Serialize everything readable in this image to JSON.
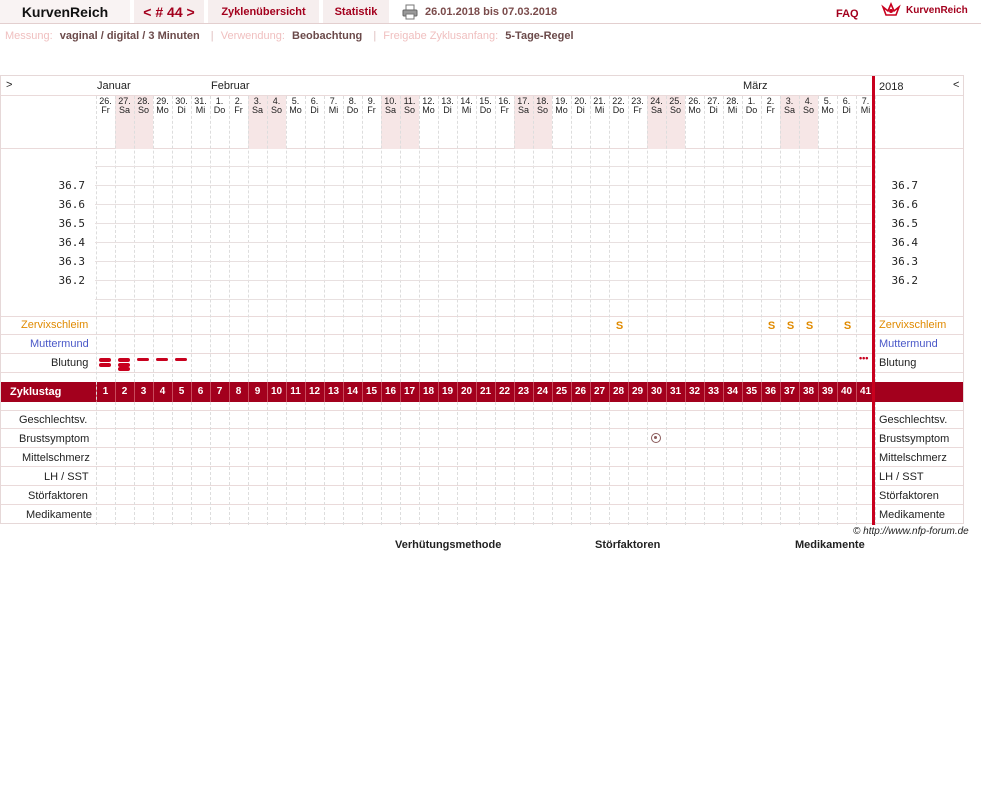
{
  "header": {
    "brand": "KurvenReich",
    "cycle_nav": "< # 44 >",
    "nav_cycles": "Zyklenübersicht",
    "nav_stats": "Statistik",
    "date_range": "26.01.2018 bis 07.03.2018",
    "faq": "FAQ",
    "logo_text": "KurvenReich"
  },
  "meta": {
    "measure_label": "Messung:",
    "measure_value": "vaginal / digital / 3 Minuten",
    "usage_label": "Verwendung:",
    "usage_value": "Beobachtung",
    "release_label": "Freigabe Zyklusanfang:",
    "release_value": "5-Tage-Regel"
  },
  "chart": {
    "arrow_left": ">",
    "arrow_right": "<",
    "year": "2018",
    "months": [
      {
        "label": "Januar",
        "day_index": 0
      },
      {
        "label": "Februar",
        "day_index": 6
      },
      {
        "label": "März",
        "day_index": 34
      }
    ],
    "days": [
      {
        "d": "26.",
        "w": "Fr"
      },
      {
        "d": "27.",
        "w": "Sa"
      },
      {
        "d": "28.",
        "w": "So"
      },
      {
        "d": "29.",
        "w": "Mo"
      },
      {
        "d": "30.",
        "w": "Di"
      },
      {
        "d": "31.",
        "w": "Mi"
      },
      {
        "d": "1.",
        "w": "Do"
      },
      {
        "d": "2.",
        "w": "Fr"
      },
      {
        "d": "3.",
        "w": "Sa"
      },
      {
        "d": "4.",
        "w": "So"
      },
      {
        "d": "5.",
        "w": "Mo"
      },
      {
        "d": "6.",
        "w": "Di"
      },
      {
        "d": "7.",
        "w": "Mi"
      },
      {
        "d": "8.",
        "w": "Do"
      },
      {
        "d": "9.",
        "w": "Fr"
      },
      {
        "d": "10.",
        "w": "Sa"
      },
      {
        "d": "11.",
        "w": "So"
      },
      {
        "d": "12.",
        "w": "Mo"
      },
      {
        "d": "13.",
        "w": "Di"
      },
      {
        "d": "14.",
        "w": "Mi"
      },
      {
        "d": "15.",
        "w": "Do"
      },
      {
        "d": "16.",
        "w": "Fr"
      },
      {
        "d": "17.",
        "w": "Sa"
      },
      {
        "d": "18.",
        "w": "So"
      },
      {
        "d": "19.",
        "w": "Mo"
      },
      {
        "d": "20.",
        "w": "Di"
      },
      {
        "d": "21.",
        "w": "Mi"
      },
      {
        "d": "22.",
        "w": "Do"
      },
      {
        "d": "23.",
        "w": "Fr"
      },
      {
        "d": "24.",
        "w": "Sa"
      },
      {
        "d": "25.",
        "w": "So"
      },
      {
        "d": "26.",
        "w": "Mo"
      },
      {
        "d": "27.",
        "w": "Di"
      },
      {
        "d": "28.",
        "w": "Mi"
      },
      {
        "d": "1.",
        "w": "Do"
      },
      {
        "d": "2.",
        "w": "Fr"
      },
      {
        "d": "3.",
        "w": "Sa"
      },
      {
        "d": "4.",
        "w": "So"
      },
      {
        "d": "5.",
        "w": "Mo"
      },
      {
        "d": "6.",
        "w": "Di"
      },
      {
        "d": "7.",
        "w": "Mi"
      }
    ],
    "temperatures": [
      "36.7",
      "36.6",
      "36.5",
      "36.4",
      "36.3",
      "36.2"
    ],
    "rows": {
      "cervix": "Zervixschleim",
      "cervix_pos": "Muttermund",
      "bleeding": "Blutung",
      "cycle_day": "Zyklustag",
      "intercourse": "Geschlechtsv.",
      "breast": "Brustsymptom",
      "mittelschmerz": "Mittelschmerz",
      "lh": "LH / SST",
      "disturb": "Störfaktoren",
      "meds": "Medikamente"
    },
    "cervix_marks": {
      "symbol": "S",
      "days": [
        28,
        36,
        37,
        38,
        40
      ]
    },
    "bleeding_strength": [
      {
        "day": 1,
        "level": 2
      },
      {
        "day": 2,
        "level": 3
      },
      {
        "day": 3,
        "level": 1
      },
      {
        "day": 4,
        "level": 1
      },
      {
        "day": 5,
        "level": 1
      }
    ],
    "spotting": {
      "day": 41,
      "symbol": "•••"
    },
    "breast_symptom_days": [
      30
    ],
    "colors": {
      "accent": "#a3001d",
      "cervix": "#e08a00",
      "cervix_pos": "#4a58c8",
      "weekend": "#f6e6e6"
    }
  },
  "footer": {
    "copyright": "© http://www.nfp-forum.de",
    "legend_contraception": "Verhütungsmethode",
    "legend_disturb": "Störfaktoren",
    "legend_meds": "Medikamente"
  }
}
